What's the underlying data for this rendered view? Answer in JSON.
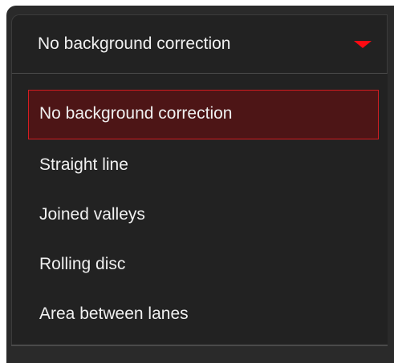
{
  "dropdown": {
    "selected_label": "No background correction",
    "accent_color": "#ff0a12",
    "options": [
      {
        "label": "No background correction",
        "selected": true
      },
      {
        "label": "Straight line",
        "selected": false
      },
      {
        "label": "Joined valleys",
        "selected": false
      },
      {
        "label": "Rolling disc",
        "selected": false
      },
      {
        "label": "Area between lanes",
        "selected": false
      }
    ]
  }
}
